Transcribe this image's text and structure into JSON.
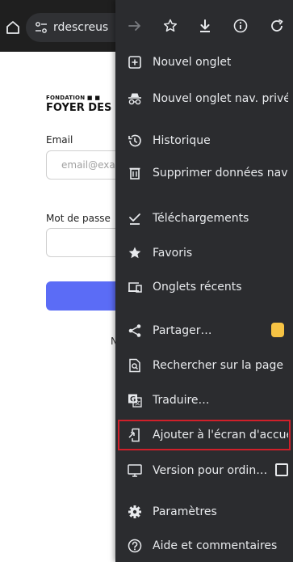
{
  "browser": {
    "url_text": "rdescreus"
  },
  "page": {
    "brand_small": "FONDATION ■ ■",
    "brand_big": "FOYER DES C",
    "email_label": "Email",
    "email_placeholder": "email@exa",
    "password_label": "Mot de passe",
    "partial_text": "N"
  },
  "menu": {
    "items": [
      {
        "label": "Nouvel onglet",
        "icon": "plus-box-icon"
      },
      {
        "label": "Nouvel onglet nav. privée",
        "icon": "incognito-icon"
      },
      {
        "label": "Historique",
        "icon": "history-icon"
      },
      {
        "label": "Supprimer données navi…",
        "icon": "trash-icon"
      },
      {
        "label": "Téléchargements",
        "icon": "download-done-icon"
      },
      {
        "label": "Favoris",
        "icon": "star-icon"
      },
      {
        "label": "Onglets récents",
        "icon": "recent-tabs-icon"
      },
      {
        "label": "Partager…",
        "icon": "share-icon"
      },
      {
        "label": "Rechercher sur la page",
        "icon": "find-in-page-icon"
      },
      {
        "label": "Traduire…",
        "icon": "translate-icon"
      },
      {
        "label": "Ajouter à l'écran d'accueil",
        "icon": "add-to-home-icon"
      },
      {
        "label": "Version pour ordin…",
        "icon": "desktop-icon"
      },
      {
        "label": "Paramètres",
        "icon": "settings-icon"
      },
      {
        "label": "Aide et commentaires",
        "icon": "help-icon"
      }
    ]
  },
  "colors": {
    "menu_bg": "#2b2c2f",
    "highlight": "#d0202a",
    "submit_button": "#5b6cf6"
  }
}
